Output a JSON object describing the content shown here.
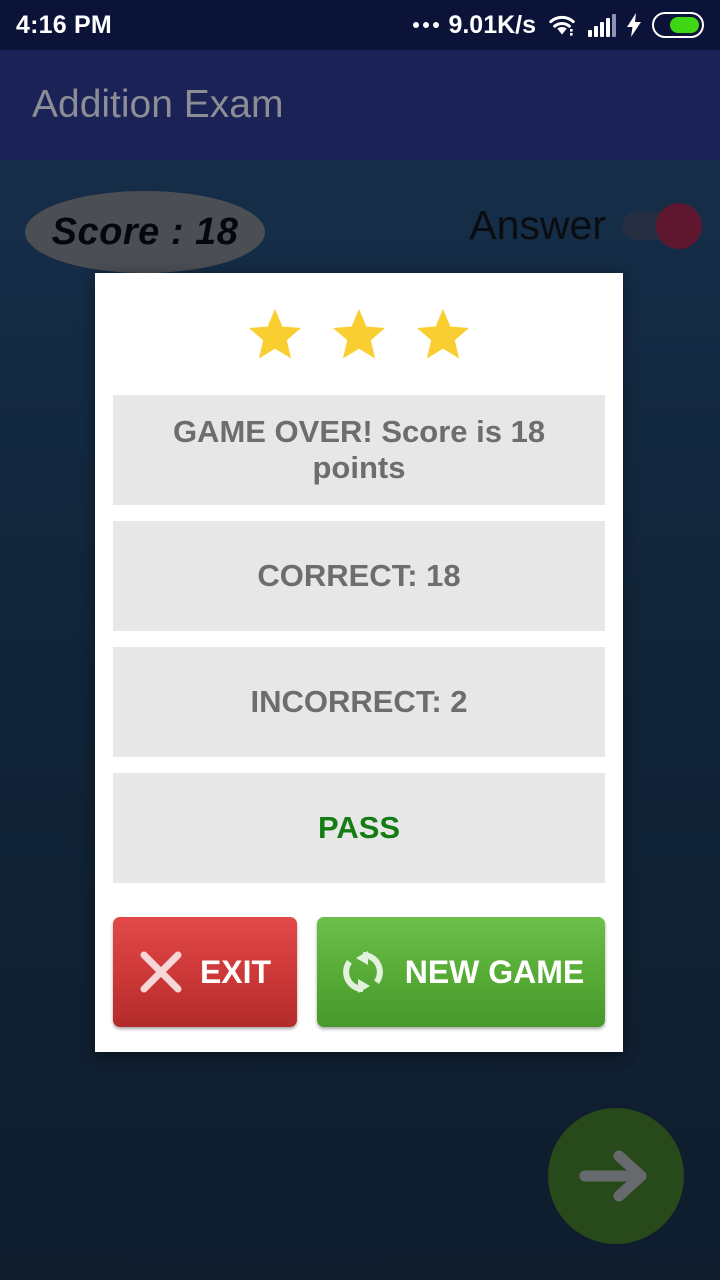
{
  "status_bar": {
    "clock": "4:16 PM",
    "network_speed": "9.01K/s",
    "icons": [
      "more-dots-icon",
      "wifi-icon",
      "cellular-signal-icon",
      "charging-bolt-icon",
      "battery-icon"
    ],
    "battery_color": "#3fd613"
  },
  "app_bar": {
    "title": "Addition Exam",
    "background": "#1a2256",
    "title_color": "#8d8d95"
  },
  "game": {
    "score_label": "Score : 18",
    "answer_label": "Answer",
    "answer_toggle_state": "on",
    "answer_toggle_thumb_color": "#9e1b3c",
    "next_button_icon": "arrow-right-icon",
    "next_button_color": "#3f7118"
  },
  "dialog": {
    "stars": 3,
    "star_color": "#f9ce31",
    "rows": [
      {
        "text": "GAME OVER! Score is 18 points",
        "style": "normal"
      },
      {
        "text": "CORRECT: 18",
        "style": "normal"
      },
      {
        "text": "INCORRECT: 2",
        "style": "normal"
      },
      {
        "text": "PASS",
        "style": "pass"
      }
    ],
    "buttons": {
      "exit": {
        "label": "EXIT",
        "icon": "close-x-icon",
        "color": "#d13a3a"
      },
      "new_game": {
        "label": "NEW GAME",
        "icon": "refresh-icon",
        "color": "#58ad37"
      }
    }
  }
}
